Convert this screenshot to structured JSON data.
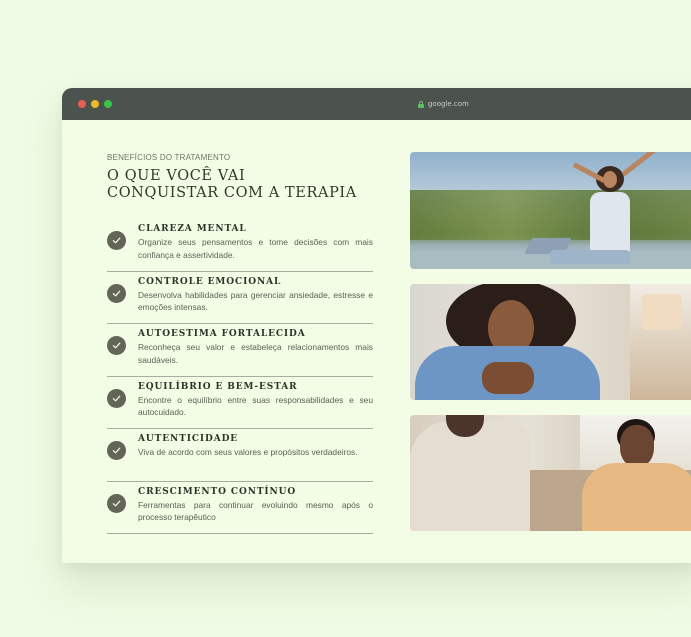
{
  "browser": {
    "url": "google.com",
    "controls": [
      "close",
      "minimize",
      "maximize"
    ]
  },
  "section": {
    "eyebrow": "BENEFÍCIOS DO TRATAMENTO",
    "heading_line1": "O QUE VOCÊ VAI",
    "heading_line2": "CONQUISTAR COM A TERAPIA"
  },
  "benefits": [
    {
      "title": "CLAREZA MENTAL",
      "desc": "Organize seus pensamentos e tome decisões com mais confiança e assertividade."
    },
    {
      "title": "CONTROLE EMOCIONAL",
      "desc": "Desenvolva habilidades para gerenciar ansiedade, estresse e emoções intensas."
    },
    {
      "title": "AUTOESTIMA FORTALECIDA",
      "desc": "Reconheça seu valor e estabeleça relacionamentos mais saudáveis."
    },
    {
      "title": "EQUILÍBRIO E BEM-ESTAR",
      "desc": "Encontre o equilíbrio entre suas responsabilidades e seu autocuidado."
    },
    {
      "title": "AUTENTICIDADE",
      "desc": "Viva de acordo com seus valores e propósitos verdadeiros."
    },
    {
      "title": "CRESCIMENTO CONTÍNUO",
      "desc": "Ferramentas para continuar evoluindo mesmo após o processo terapêutico"
    }
  ],
  "colors": {
    "page_bg": "#effbe4",
    "card_bg": "#f3fde5",
    "titlebar": "#4c524e",
    "check_bg": "#636656",
    "heading": "#2f3a2c"
  }
}
